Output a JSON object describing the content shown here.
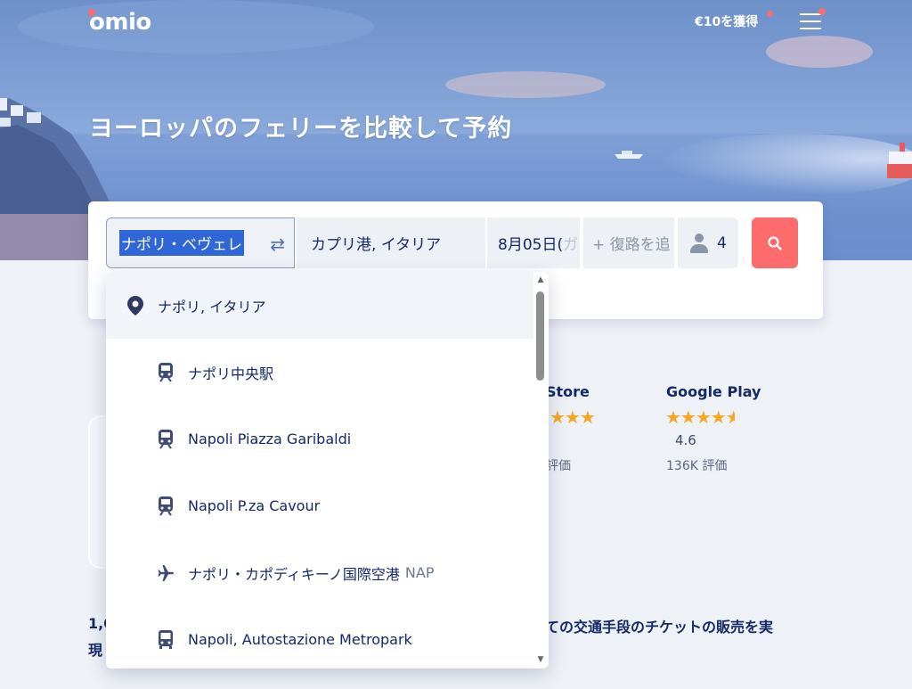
{
  "header": {
    "logo": "omio",
    "earn_label": "€10を獲得",
    "menu_icon": "hamburger-menu-icon"
  },
  "hero": {
    "title": "ヨーロッパのフェリーを比較して予約"
  },
  "search": {
    "from_value": "ナポリ・ベヴェレ",
    "to_value": "カプリ港, イタリア",
    "date_value": "8月05日(",
    "date_overflow": "ガ",
    "return_placeholder": "+ 復路を追",
    "passengers": "4",
    "swap_icon": "swap-arrows-icon",
    "search_icon": "search-icon",
    "accent_color": "#fc6c6c"
  },
  "dropdown": {
    "items": [
      {
        "label": "ナポリ, イタリア",
        "icon": "location-pin-icon",
        "code": ""
      },
      {
        "label": "ナポリ中央駅",
        "icon": "train-icon",
        "code": ""
      },
      {
        "label": "Napoli Piazza Garibaldi",
        "icon": "train-icon",
        "code": ""
      },
      {
        "label": "Napoli P.za Cavour",
        "icon": "train-icon",
        "code": ""
      },
      {
        "label": "ナポリ・カポディキーノ国際空港",
        "icon": "plane-icon",
        "code": "NAP"
      },
      {
        "label": "Napoli, Autostazione Metropark",
        "icon": "bus-icon",
        "code": ""
      }
    ]
  },
  "ratings": {
    "app_store": {
      "label": "Store",
      "reviews_suffix": "評価"
    },
    "google_play": {
      "label": "Google Play",
      "rating": "4.6",
      "reviews": "136K 評価",
      "stars": 4.5
    }
  },
  "bottom": {
    "left_fragment_1": "1,0",
    "left_fragment_2": "現",
    "right_text": "ての交通手段のチケットの販売を実"
  }
}
